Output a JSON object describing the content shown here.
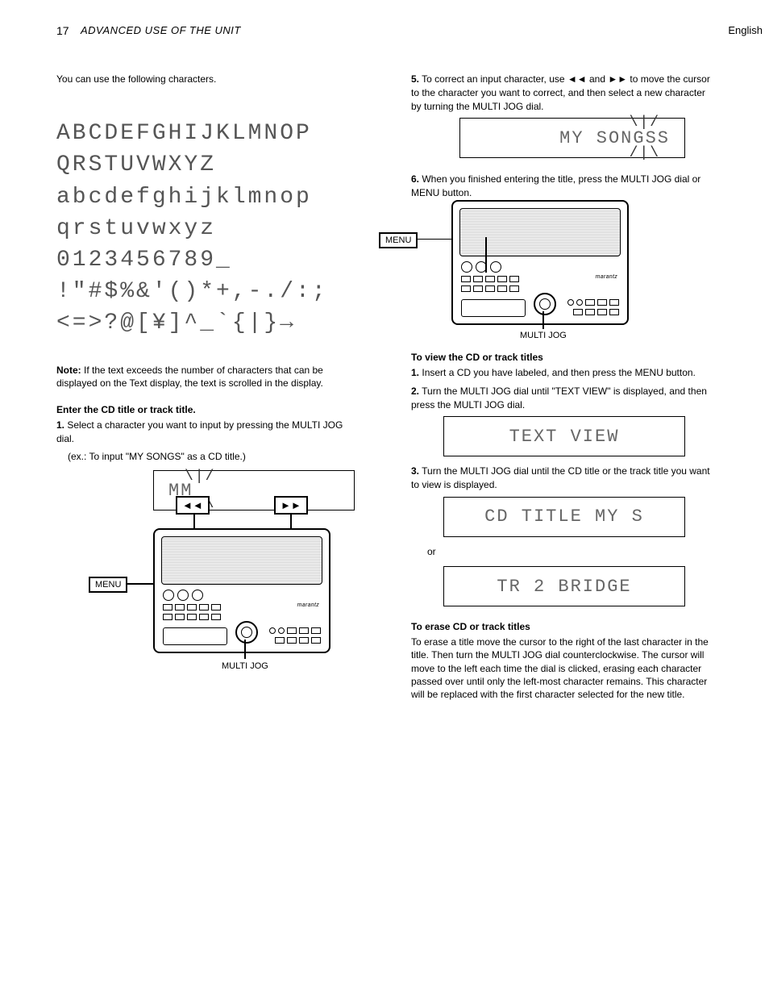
{
  "page": {
    "number": "17",
    "title": "ADVANCED USE OF THE UNIT",
    "language_tab": "English"
  },
  "left": {
    "intro": "You can use the following characters.",
    "charset": "ABCDEFGHIJKLMNOP\nQRSTUVWXYZ\nabcdefghijklmnop\nqrstuvwxyz\n0123456789_\n!\"#$%&'()*+,-./:;\n<=>?@[¥]^_`{|}→",
    "note_bold": "Note:",
    "note_text": " If the text exceeds the number of characters that can be displayed on the Text display, the text is scrolled in the display.",
    "heading": "Enter the CD title or track title.",
    "step1_label": "1.",
    "step1_text": "Select a character you want to input by pressing the MULTI JOG dial.",
    "step1_sub": "(ex.: To input \"MY SONGS\" as a CD title.)",
    "lcd_mm": "MM",
    "buttons": {
      "menu": "MENU",
      "prev": "◄◄",
      "next": "►►"
    },
    "multi_jog_caption": "MULTI JOG"
  },
  "right": {
    "step5_label": "5.",
    "step5_text": "To correct an input character, use ◄◄ and ►► to move the cursor to the character you want to correct, and then select a new character by turning the MULTI JOG dial.",
    "step6_label": "6.",
    "step6_text": "When you finished entering the title, press the MULTI JOG dial or MENU button.",
    "lcd_mysongs": "MY SONGSS",
    "find_label": {
      "menu": "MENU"
    },
    "multi_jog_caption": "MULTI JOG",
    "view_heading": "To view the CD or track titles",
    "view_step1_label": "1.",
    "view_step1_text": "Insert a CD you have labeled, and then press the MENU button.",
    "view_step2_label": "2.",
    "view_step2_text": "Turn the MULTI JOG dial until \"TEXT VIEW\" is displayed, and then press the MULTI JOG dial.",
    "lcd_textview": "TEXT VIEW",
    "view_step3_label": "3.",
    "view_step3_text": "Turn the MULTI JOG dial until the CD title or the track title you want to view is displayed.",
    "lcd_cdtitle": "CD TITLE MY S",
    "or_text": "or",
    "lcd_tr": "TR  2 BRIDGE",
    "erase_heading": "To erase CD or track titles",
    "erase_text": "To erase a title move the cursor to the right of the last character in the title. Then turn the MULTI JOG dial counterclockwise. The cursor will move to the left each time the dial is clicked, erasing each character passed over until only the left-most character remains. This character will be replaced with the first character selected for the new title."
  }
}
